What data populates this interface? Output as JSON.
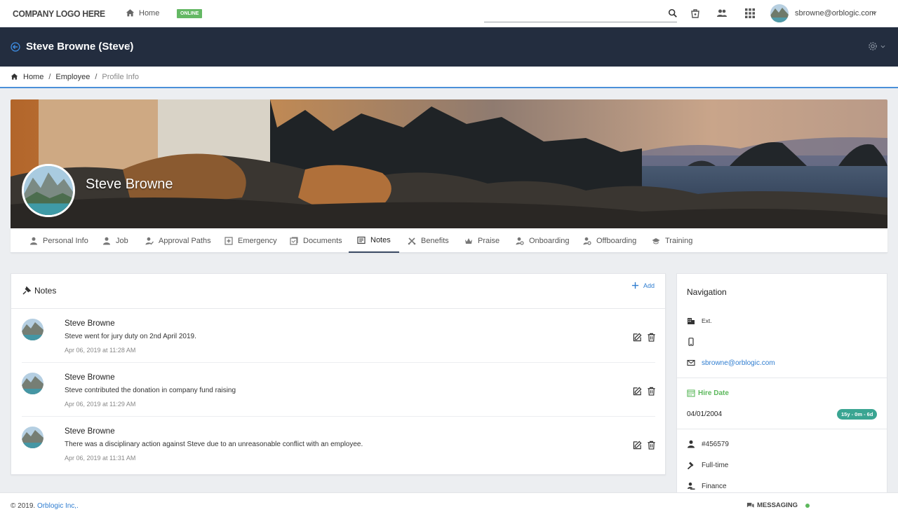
{
  "topbar": {
    "logo": "COMPANY LOGO HERE",
    "home_label": "Home",
    "status_badge": "ONLINE",
    "user_email": "sbrowne@orblogic.com"
  },
  "titlebar": {
    "title": "Steve Browne (Steve)",
    "separator": "/"
  },
  "breadcrumb": {
    "items": [
      "Home",
      "Employee",
      "Profile Info"
    ]
  },
  "profile": {
    "name": "Steve Browne"
  },
  "tabs": [
    {
      "label": "Personal Info",
      "icon": "person-icon"
    },
    {
      "label": "Job",
      "icon": "person-icon"
    },
    {
      "label": "Approval Paths",
      "icon": "person-check-icon"
    },
    {
      "label": "Emergency",
      "icon": "plus-square-icon"
    },
    {
      "label": "Documents",
      "icon": "documents-icon"
    },
    {
      "label": "Notes",
      "icon": "notes-icon",
      "active": true
    },
    {
      "label": "Benefits",
      "icon": "benefits-icon"
    },
    {
      "label": "Praise",
      "icon": "crown-icon"
    },
    {
      "label": "Onboarding",
      "icon": "person-gear-icon"
    },
    {
      "label": "Offboarding",
      "icon": "person-gear-icon"
    },
    {
      "label": "Training",
      "icon": "graduation-cap-icon"
    }
  ],
  "notes": {
    "title": "Notes",
    "add_label": "Add",
    "items": [
      {
        "author": "Steve Browne",
        "text": "Steve went for jury duty on 2nd April 2019.",
        "time": "Apr 06, 2019 at 11:28 AM"
      },
      {
        "author": "Steve Browne",
        "text": "Steve contributed the donation in company fund raising",
        "time": "Apr 06, 2019 at 11:29 AM"
      },
      {
        "author": "Steve Browne",
        "text": "There was a disciplinary action against Steve due to an unreasonable conflict with an employee.",
        "time": "Apr 06, 2019 at 11:31 AM"
      }
    ]
  },
  "navigation": {
    "title": "Navigation",
    "ext_label": "Ext.",
    "email": "sbrowne@orblogic.com",
    "hire_date_title": "Hire Date",
    "hire_date": "04/01/2004",
    "tenure": "15y - 0m - 6d",
    "employee_id": "#456579",
    "employment_type": "Full-time",
    "department": "Finance"
  },
  "footer": {
    "copyright": "© 2019.",
    "company": "Orblogic Inc,.",
    "messaging": "MESSAGING"
  },
  "colors": {
    "titlebar_bg": "#232d3f",
    "accent_blue": "#2f7dd0",
    "online_green": "#64b864",
    "tenure_teal": "#3aa592"
  }
}
